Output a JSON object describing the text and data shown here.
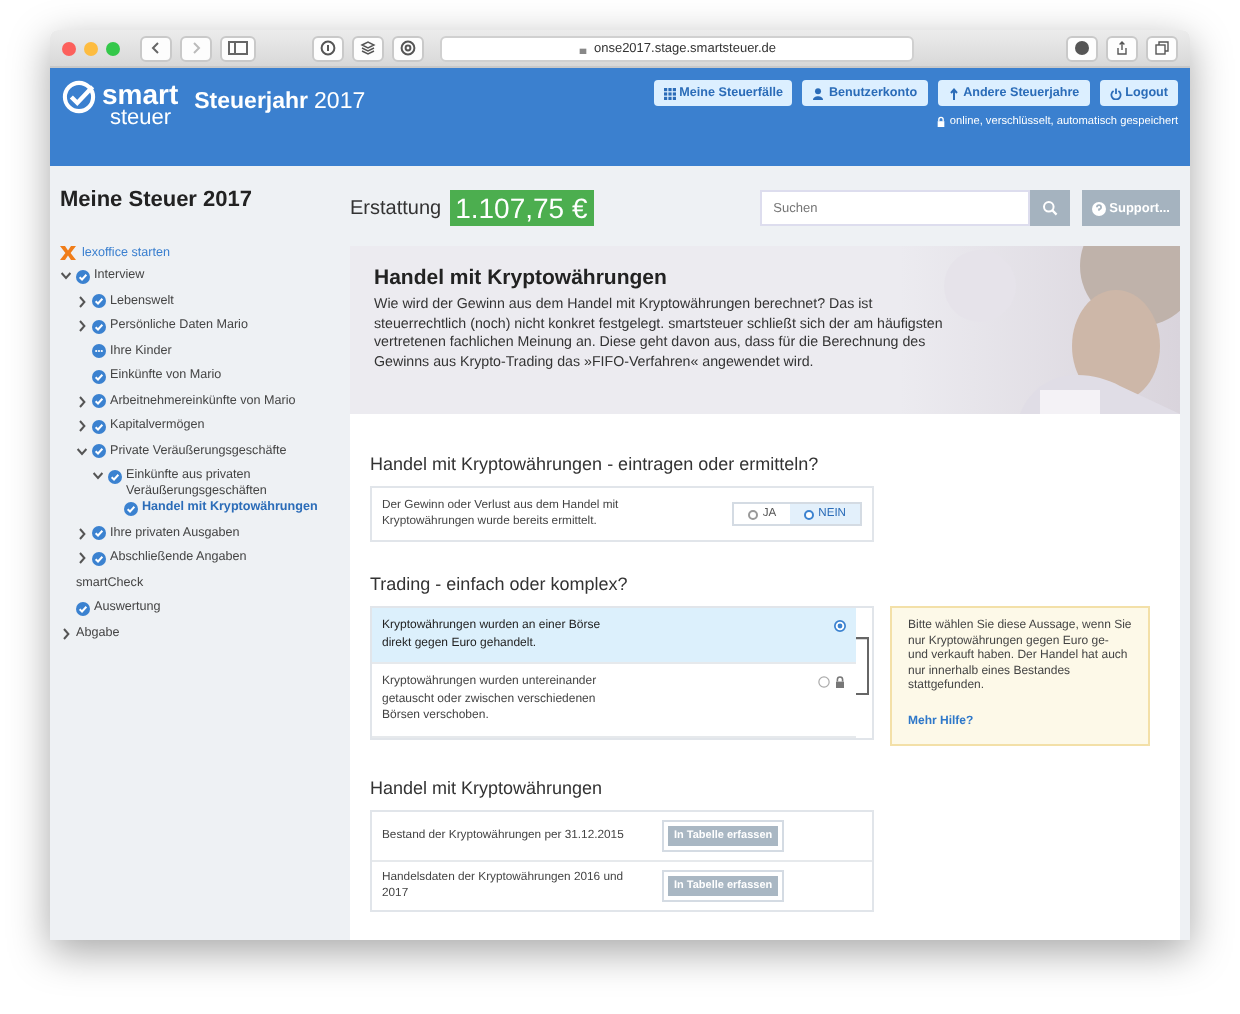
{
  "browser": {
    "url": "onse2017.stage.smartsteuer.de"
  },
  "header": {
    "logo_top": "smart",
    "logo_bottom": "steuer",
    "title": "Steuerjahr",
    "year": "2017",
    "buttons": [
      {
        "label": "Meine Steuerfälle"
      },
      {
        "label": "Benutzerkonto"
      },
      {
        "label": "Andere Steuerjahre"
      },
      {
        "label": "Logout"
      }
    ],
    "status": "online, verschlüsselt, automatisch gespeichert"
  },
  "sidebar": {
    "title": "Meine Steuer 2017",
    "lexoffice_link": "lexoffice starten",
    "tree": [
      {
        "label": "Interview",
        "kind": "done",
        "expanded": true,
        "selected": false,
        "children": [
          {
            "label": "Lebenswelt",
            "kind": "done",
            "expanded": false,
            "selected": false
          },
          {
            "label": "Persönliche Daten Mario",
            "kind": "done",
            "expanded": false,
            "selected": false
          },
          {
            "label": "Ihre Kinder",
            "kind": "pending",
            "selected": false
          },
          {
            "label": "Einkünfte von Mario",
            "kind": "done",
            "selected": false
          },
          {
            "label": "Arbeitnehmereinkünfte von Mario",
            "kind": "done",
            "expanded": false,
            "selected": false
          },
          {
            "label": "Kapitalvermögen",
            "kind": "done",
            "expanded": false,
            "selected": false
          },
          {
            "label": "Private Veräußerungsgeschäfte",
            "kind": "done",
            "expanded": true,
            "selected": false,
            "children": [
              {
                "label": "Einkünfte aus privaten Veräußerungsgeschäften",
                "kind": "done",
                "expanded": true,
                "selected": false,
                "children": [
                  {
                    "label": "Handel mit Kryptowährungen",
                    "kind": "done",
                    "selected": true
                  }
                ]
              }
            ]
          },
          {
            "label": "Ihre privaten Ausgaben",
            "kind": "done",
            "expanded": false,
            "selected": false
          },
          {
            "label": "Abschließende Angaben",
            "kind": "done",
            "expanded": false,
            "selected": false
          }
        ]
      },
      {
        "label": "smartCheck",
        "kind": "plain",
        "selected": false
      },
      {
        "label": "Auswertung",
        "kind": "done",
        "selected": false
      },
      {
        "label": "Abgabe",
        "kind": "plain",
        "expanded": false,
        "selected": false
      }
    ]
  },
  "refund": {
    "label": "Erstattung",
    "amount": "1.107,75 €"
  },
  "search": {
    "placeholder": "Suchen"
  },
  "support_button": "Support...",
  "hero": {
    "title": "Handel mit Kryptowährungen",
    "text": "Wie wird der Gewinn aus dem Handel mit Kryptowährungen berechnet? Das ist steuerrechtlich (noch) nicht konkret festgelegt. smartsteuer schließt sich der am häufigsten vertretenen fachlichen Meinung an. Diese geht davon aus, dass für die Berechnung des Gewinns aus Krypto-Trading das »FIFO-Verfahren« angewendet wird."
  },
  "sections": [
    {
      "kind": "yesno",
      "heading": "Handel mit Kryptowährungen - eintragen oder ermitteln?",
      "question": "Der Gewinn oder Verlust aus dem Handel mit Kryptowährungen wurde bereits ermittelt.",
      "options": [
        {
          "label": "JA",
          "selected": false
        },
        {
          "label": "NEIN",
          "selected": true
        }
      ]
    },
    {
      "kind": "choice",
      "heading": "Trading - einfach oder komplex?",
      "options": [
        {
          "text": "Kryptowährungen wurden an einer Börse direkt gegen Euro gehandelt.",
          "selected": true,
          "locked": false
        },
        {
          "text": "Kryptowährungen wurden untereinander getauscht oder zwischen verschiedenen Börsen verschoben.",
          "selected": false,
          "locked": true
        }
      ],
      "help": {
        "text": "Bitte wählen Sie diese Aussage, wenn Sie nur Kryptowährungen gegen Euro ge- und verkauft haben. Der Handel hat auch nur innerhalb eines Bestandes stattgefunden.",
        "link": "Mehr Hilfe?"
      }
    },
    {
      "kind": "table",
      "heading": "Handel mit Kryptowährungen",
      "rows": [
        {
          "text": "Bestand der Kryptowährungen per 31.12.2015",
          "button": "In Tabelle erfassen"
        },
        {
          "text": "Handelsdaten der Kryptowährungen 2016 und 2017",
          "button": "In Tabelle erfassen"
        }
      ]
    }
  ]
}
